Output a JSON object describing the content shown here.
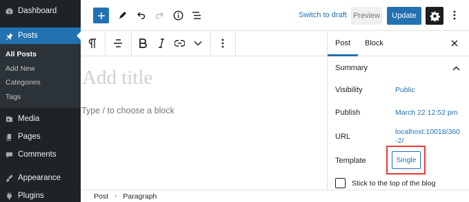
{
  "sidebar": {
    "items": [
      {
        "label": "Dashboard",
        "icon": "dashboard-icon"
      },
      {
        "label": "Posts",
        "icon": "pin-icon",
        "active": true
      },
      {
        "label": "Media",
        "icon": "media-icon"
      },
      {
        "label": "Pages",
        "icon": "pages-icon"
      },
      {
        "label": "Comments",
        "icon": "comment-icon"
      },
      {
        "label": "Appearance",
        "icon": "brush-icon"
      },
      {
        "label": "Plugins",
        "icon": "plugin-icon"
      }
    ],
    "submenu": [
      "All Posts",
      "Add New",
      "Categories",
      "Tags"
    ]
  },
  "header": {
    "switch_to_draft": "Switch to draft",
    "preview": "Preview",
    "update": "Update",
    "icons": [
      "plus-icon",
      "pencil-icon",
      "undo-icon",
      "redo-icon",
      "info-icon",
      "list-view-icon",
      "gear-icon",
      "more-vertical-icon"
    ]
  },
  "block_toolbar": {
    "icons": [
      "paragraph-icon",
      "align-left-icon",
      "bold-icon",
      "italic-icon",
      "link-icon",
      "chevron-down-icon",
      "more-vertical-icon"
    ]
  },
  "canvas": {
    "title_placeholder": "Add title",
    "block_placeholder": "Type / to choose a block"
  },
  "settings": {
    "tabs": [
      "Post",
      "Block"
    ],
    "panel_title": "Summary",
    "rows": {
      "visibility": {
        "label": "Visibility",
        "value": "Public"
      },
      "publish": {
        "label": "Publish",
        "value": "March 22 12:52 pm"
      },
      "url": {
        "label": "URL",
        "value_line1": "localhost:10018/360",
        "value_line2": "-2/"
      },
      "template": {
        "label": "Template",
        "value": "Single"
      }
    },
    "sticky_label": "Stick to the top of the blog"
  },
  "footer": {
    "breadcrumbs": [
      "Post",
      "Paragraph"
    ]
  },
  "colors": {
    "admin_bg": "#1d2327",
    "accent": "#2271b1",
    "highlight": "#e53935"
  }
}
